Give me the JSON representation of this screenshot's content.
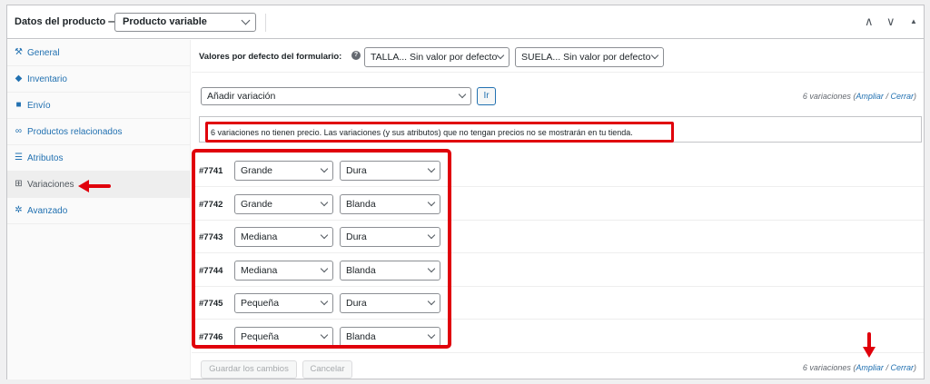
{
  "header": {
    "title": "Datos del producto —",
    "product_type": "Producto variable",
    "ctrl_up": "∧",
    "ctrl_down": "∨",
    "ctrl_toggle": "▲"
  },
  "sidebar": {
    "items": [
      {
        "label": "General",
        "icon": "wrench-icon",
        "glyph": "⚒"
      },
      {
        "label": "Inventario",
        "icon": "tag-icon",
        "glyph": "◆"
      },
      {
        "label": "Envío",
        "icon": "truck-icon",
        "glyph": "■"
      },
      {
        "label": "Productos relacionados",
        "icon": "link-icon",
        "glyph": "∞"
      },
      {
        "label": "Atributos",
        "icon": "list-icon",
        "glyph": "☰"
      },
      {
        "label": "Variaciones",
        "icon": "grid-icon",
        "glyph": "⊞"
      },
      {
        "label": "Avanzado",
        "icon": "gear-icon",
        "glyph": "✲"
      }
    ],
    "active_index": 5
  },
  "defaults": {
    "label": "Valores por defecto del formulario:",
    "help_glyph": "?",
    "talla": "TALLA... Sin valor por defecto",
    "suela": "SUELA... Sin valor por defecto"
  },
  "add": {
    "select_value": "Añadir variación",
    "go_label": "Ir"
  },
  "count": {
    "text": "6 variaciones",
    "open_paren": "(",
    "expand": "Ampliar",
    "separator": "/",
    "close": "Cerrar",
    "close_paren": ")"
  },
  "notice": "6 variaciones no tienen precio. Las variaciones (y sus atributos) que no tengan precios no se mostrarán en tu tienda.",
  "variations": [
    {
      "id": "#7741",
      "talla": "Grande",
      "suela": "Dura"
    },
    {
      "id": "#7742",
      "talla": "Grande",
      "suela": "Blanda"
    },
    {
      "id": "#7743",
      "talla": "Mediana",
      "suela": "Dura"
    },
    {
      "id": "#7744",
      "talla": "Mediana",
      "suela": "Blanda"
    },
    {
      "id": "#7745",
      "talla": "Pequeña",
      "suela": "Dura"
    },
    {
      "id": "#7746",
      "talla": "Pequeña",
      "suela": "Blanda"
    }
  ],
  "footer": {
    "save_label": "Guardar los cambios",
    "cancel_label": "Cancelar"
  },
  "colors": {
    "highlight": "#e0000b",
    "link": "#2271b1"
  }
}
